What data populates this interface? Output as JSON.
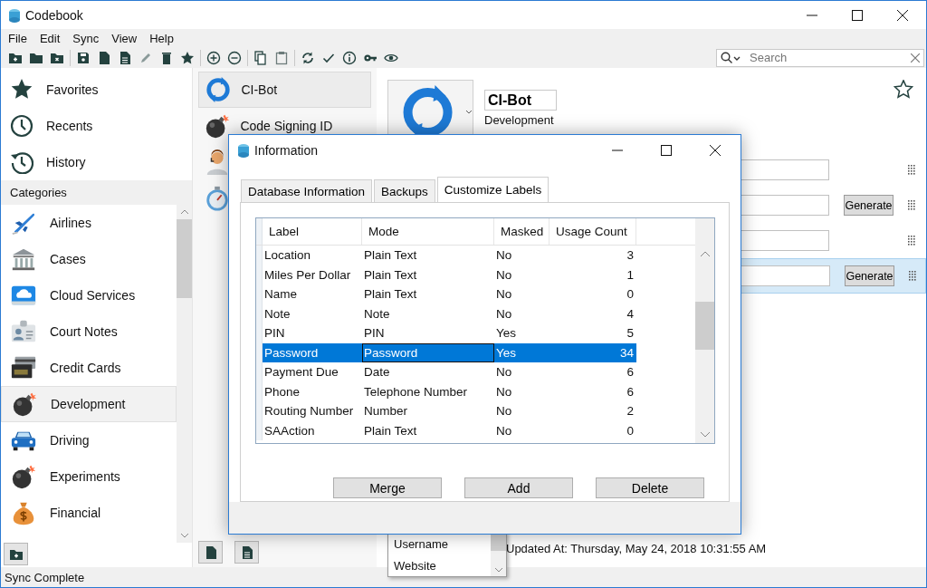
{
  "window": {
    "title": "Codebook"
  },
  "menu": [
    "File",
    "Edit",
    "Sync",
    "View",
    "Help"
  ],
  "search": {
    "placeholder": "Search"
  },
  "sidebar": {
    "shortcuts": [
      {
        "label": "Favorites",
        "selected": false
      },
      {
        "label": "Recents",
        "selected": false
      },
      {
        "label": "History",
        "selected": false
      }
    ],
    "categories_header": "Categories",
    "categories": [
      {
        "label": "Airlines",
        "selected": false
      },
      {
        "label": "Cases",
        "selected": false
      },
      {
        "label": "Cloud Services",
        "selected": false
      },
      {
        "label": "Court Notes",
        "selected": false
      },
      {
        "label": "Credit Cards",
        "selected": false
      },
      {
        "label": "Development",
        "selected": true
      },
      {
        "label": "Driving",
        "selected": false
      },
      {
        "label": "Experiments",
        "selected": false
      },
      {
        "label": "Financial",
        "selected": false
      }
    ]
  },
  "entries": [
    {
      "name": "CI-Bot",
      "selected": true
    },
    {
      "name": "Code Signing ID",
      "selected": false
    },
    {
      "selected": false
    },
    {
      "selected": false
    }
  ],
  "detail": {
    "title": "CI-Bot",
    "category": "Development",
    "favorite": false,
    "fields": [
      {
        "selected": false
      },
      {
        "button": "Generate",
        "selected": false
      },
      {
        "selected": false
      },
      {
        "button": "Generate",
        "selected": true
      }
    ],
    "dropdown": {
      "options": [
        "Username",
        "Website"
      ]
    },
    "updated": "Updated At: Thursday, May 24, 2018 10:31:55 AM"
  },
  "status_bar": "Sync Complete",
  "dialog": {
    "title": "Information",
    "tabs": [
      {
        "label": "Database Information",
        "selected": false
      },
      {
        "label": "Backups",
        "selected": false
      },
      {
        "label": "Customize Labels",
        "selected": true
      }
    ],
    "table": {
      "columns": [
        "Label",
        "Mode",
        "Masked",
        "Usage Count"
      ],
      "rows": [
        {
          "cells": [
            "Location",
            "Plain Text",
            "No",
            "3"
          ],
          "selected": false
        },
        {
          "cells": [
            "Miles Per Dollar",
            "Plain Text",
            "No",
            "1"
          ],
          "selected": false
        },
        {
          "cells": [
            "Name",
            "Plain Text",
            "No",
            "0"
          ],
          "selected": false
        },
        {
          "cells": [
            "Note",
            "Note",
            "No",
            "4"
          ],
          "selected": false
        },
        {
          "cells": [
            "PIN",
            "PIN",
            "Yes",
            "5"
          ],
          "selected": false
        },
        {
          "cells": [
            "Password",
            "Password",
            "Yes",
            "34"
          ],
          "selected": true
        },
        {
          "cells": [
            "Payment Due",
            "Date",
            "No",
            "6"
          ],
          "selected": false
        },
        {
          "cells": [
            "Phone",
            "Telephone Number",
            "No",
            "6"
          ],
          "selected": false
        },
        {
          "cells": [
            "Routing Number",
            "Number",
            "No",
            "2"
          ],
          "selected": false
        },
        {
          "cells": [
            "SAAction",
            "Plain Text",
            "No",
            "0"
          ],
          "selected": false
        }
      ]
    },
    "buttons": [
      "Merge",
      "Add",
      "Delete"
    ]
  }
}
